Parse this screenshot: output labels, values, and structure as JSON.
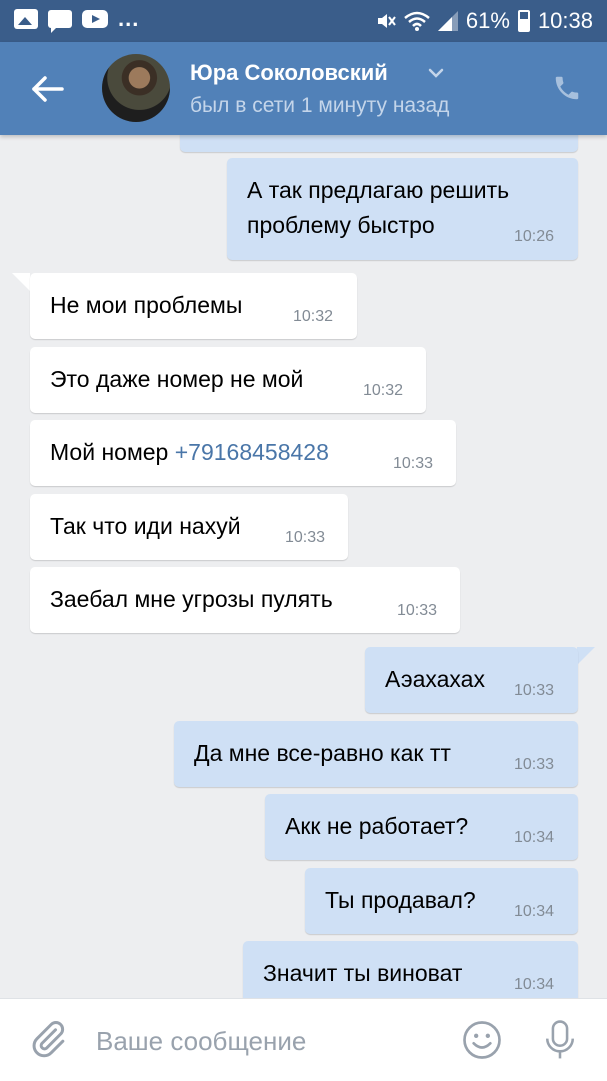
{
  "status_bar": {
    "dots": "...",
    "battery": "61%",
    "time": "10:38"
  },
  "header": {
    "name": "Юра Соколовский",
    "status": "был в сети 1 минуту назад"
  },
  "messages": [
    {
      "dir": "out",
      "text_lines": [
        "А так предлагаю решить",
        "проблему быстро"
      ],
      "time": "10:26"
    },
    {
      "dir": "in",
      "text": "Не мои проблемы",
      "time": "10:32"
    },
    {
      "dir": "in",
      "text": "Это даже номер не мой",
      "time": "10:32"
    },
    {
      "dir": "in",
      "text": "Мой номер ",
      "link": "+79168458428",
      "time": "10:33"
    },
    {
      "dir": "in",
      "text": "Так что иди нахуй",
      "time": "10:33"
    },
    {
      "dir": "in",
      "text": "Заебал мне угрозы пулять",
      "time": "10:33"
    },
    {
      "dir": "out",
      "text": "Аэахахах",
      "time": "10:33"
    },
    {
      "dir": "out",
      "text": "Да мне все-равно как тт",
      "time": "10:33"
    },
    {
      "dir": "out",
      "text": "Акк не работает?",
      "time": "10:34"
    },
    {
      "dir": "out",
      "text": "Ты продавал?",
      "time": "10:34"
    },
    {
      "dir": "out",
      "text": "Значит ты виноват",
      "time": "10:34"
    }
  ],
  "input": {
    "placeholder": "Ваше сообщение",
    "value": ""
  },
  "colors": {
    "header": "#5181b8",
    "status_bar": "#3a5d8a",
    "outgoing_bubble": "#cfe0f5",
    "incoming_bubble": "#ffffff",
    "link": "#4a76a8"
  },
  "icons": [
    "image-icon",
    "chat-icon",
    "youtube-icon",
    "mute-icon",
    "wifi-icon",
    "signal-icon",
    "battery-icon",
    "back-arrow-icon",
    "chevron-down-icon",
    "phone-icon",
    "paperclip-icon",
    "smile-icon",
    "microphone-icon"
  ]
}
